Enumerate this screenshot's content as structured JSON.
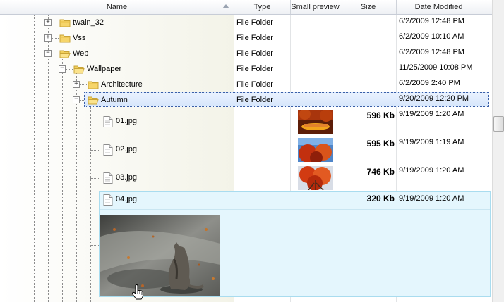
{
  "columns": {
    "name": "Name",
    "type": "Type",
    "preview": "Small preview",
    "size": "Size",
    "date": "Date Modified"
  },
  "rows": [
    {
      "name": "twain_32",
      "type": "File Folder",
      "size": "",
      "date": "6/2/2009 12:48 PM"
    },
    {
      "name": "Vss",
      "type": "File Folder",
      "size": "",
      "date": "6/2/2009 10:10 AM"
    },
    {
      "name": "Web",
      "type": "File Folder",
      "size": "",
      "date": "6/2/2009 12:48 PM"
    },
    {
      "name": "Wallpaper",
      "type": "File Folder",
      "size": "",
      "date": "11/25/2009 10:08 PM"
    },
    {
      "name": "Architecture",
      "type": "File Folder",
      "size": "",
      "date": "6/2/2009 2:40 PM"
    },
    {
      "name": "Autumn",
      "type": "File Folder",
      "size": "",
      "date": "9/20/2009 12:20 PM"
    },
    {
      "name": "01.jpg",
      "type": "",
      "size": "596 Kb",
      "date": "9/19/2009 1:20 AM"
    },
    {
      "name": "02.jpg",
      "type": "",
      "size": "595 Kb",
      "date": "9/19/2009 1:19 AM"
    },
    {
      "name": "03.jpg",
      "type": "",
      "size": "746 Kb",
      "date": "9/19/2009 1:20 AM"
    },
    {
      "name": "04.jpg",
      "type": "",
      "size": "320 Kb",
      "date": "9/19/2009 1:20 AM"
    }
  ],
  "icons": {
    "folder": "folder-icon",
    "file": "file-icon",
    "expand": "plus-box-icon",
    "collapse": "minus-box-icon",
    "cursor": "hand-pointer-icon"
  },
  "colors": {
    "selection_border": "#3a5fa8",
    "expanded_row_bg": "#e4f6fd",
    "folder_yellow": "#f6d56a"
  }
}
